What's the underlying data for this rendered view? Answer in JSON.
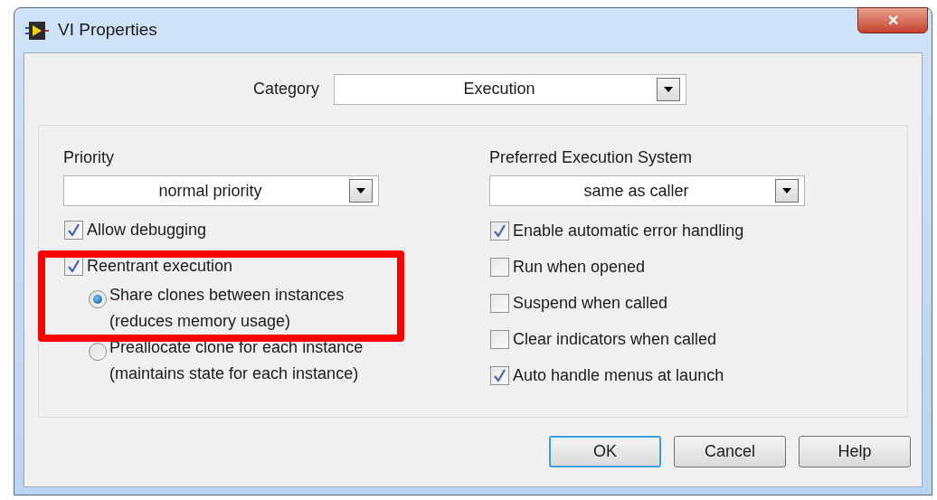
{
  "window": {
    "title": "VI Properties",
    "close": "✕"
  },
  "category": {
    "label": "Category",
    "value": "Execution"
  },
  "priority": {
    "label": "Priority",
    "value": "normal priority",
    "options": [
      {
        "label": "Allow debugging",
        "checked": true
      },
      {
        "label": "Reentrant execution",
        "checked": true
      }
    ],
    "reentrant_modes": [
      {
        "lines": [
          "Share clones between instances",
          "(reduces memory usage)"
        ],
        "selected": true
      },
      {
        "lines": [
          "Preallocate clone for each instance",
          "(maintains state for each instance)"
        ],
        "selected": false
      }
    ]
  },
  "execution_system": {
    "label": "Preferred Execution System",
    "value": "same as caller",
    "options": [
      {
        "label": "Enable automatic error handling",
        "checked": true
      },
      {
        "label": "Run when opened",
        "checked": false
      },
      {
        "label": "Suspend when called",
        "checked": false
      },
      {
        "label": "Clear indicators when called",
        "checked": false
      },
      {
        "label": "Auto handle menus at launch",
        "checked": true
      }
    ]
  },
  "buttons": [
    {
      "label": "OK",
      "default": true
    },
    {
      "label": "Cancel",
      "default": false
    },
    {
      "label": "Help",
      "default": false
    }
  ]
}
